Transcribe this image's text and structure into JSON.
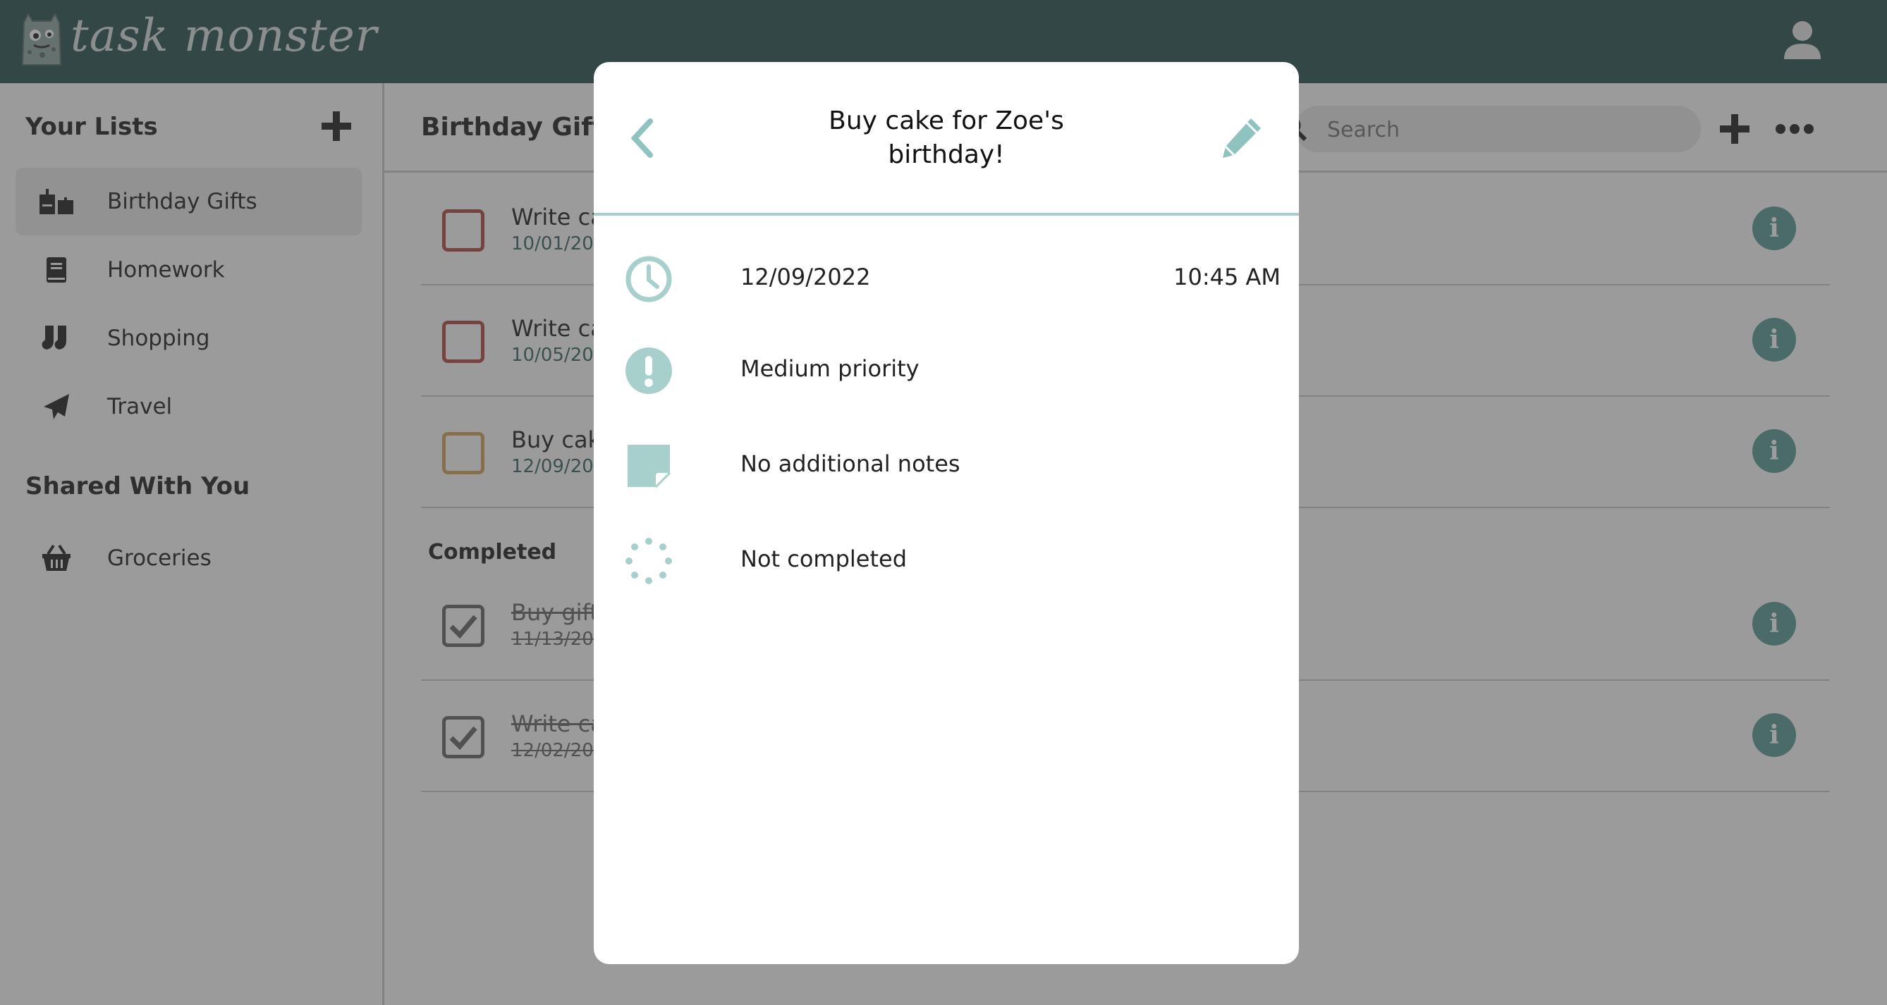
{
  "app": {
    "name": "task monster"
  },
  "colors": {
    "header": "#2d5353",
    "accent": "#9dc9c5",
    "info": "#5b9a94",
    "high": "#b24a40",
    "medium": "#d4a25a"
  },
  "sidebar": {
    "your_lists_title": "Your Lists",
    "items": [
      {
        "label": "Birthday Gifts",
        "icon": "gift-icon",
        "active": true
      },
      {
        "label": "Homework",
        "icon": "book-icon"
      },
      {
        "label": "Shopping",
        "icon": "socks-icon"
      },
      {
        "label": "Travel",
        "icon": "paper-plane-icon"
      }
    ],
    "shared_title": "Shared With You",
    "shared_items": [
      {
        "label": "Groceries",
        "icon": "basket-icon"
      }
    ]
  },
  "main": {
    "title": "Birthday Gifts",
    "search_placeholder": "Search",
    "tasks": [
      {
        "title": "Write ca",
        "date": "10/01/20"
      },
      {
        "title": "Write ca",
        "date": "10/05/20"
      },
      {
        "title": "Buy cak",
        "date": "12/09/20"
      }
    ],
    "completed_title": "Completed",
    "completed_tasks": [
      {
        "title": "Buy gift",
        "date": "11/13/20"
      },
      {
        "title": "Write ca",
        "date": "12/02/20"
      }
    ]
  },
  "modal": {
    "title": "Buy cake for Zoe's birthday!",
    "date": "12/09/2022",
    "time": "10:45 AM",
    "priority": "Medium priority",
    "notes": "No additional notes",
    "status": "Not completed"
  }
}
